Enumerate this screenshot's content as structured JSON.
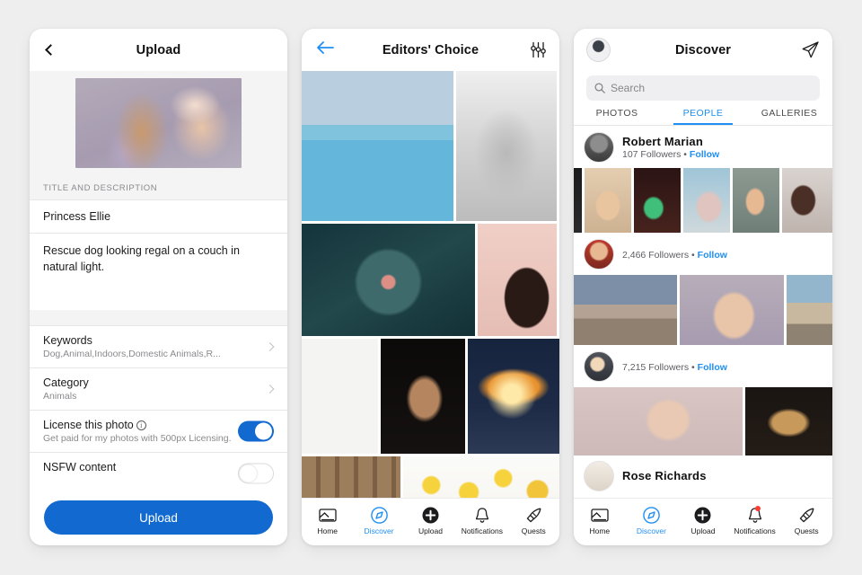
{
  "app": {
    "accent": "#1269cf",
    "tab_accent": "#1f8ff2",
    "bg": "#eeeeee"
  },
  "upload_screen": {
    "nav": {
      "back_icon": "chevron-left-icon",
      "title": "Upload"
    },
    "section_label": "TITLE AND DESCRIPTION",
    "title_value": "Princess Ellie",
    "description_value": "Rescue dog looking regal on a couch in natural light.",
    "keywords": {
      "label": "Keywords",
      "value": "Dog,Animal,Indoors,Domestic Animals,R..."
    },
    "category": {
      "label": "Category",
      "value": "Animals"
    },
    "license": {
      "label": "License this photo",
      "info_icon": "info-circle-icon",
      "sub": "Get paid for my photos with 500px Licensing.",
      "state": "on"
    },
    "nsfw": {
      "label": "NSFW content",
      "state": "off"
    },
    "submit_label": "Upload"
  },
  "editors_screen": {
    "nav": {
      "back_icon": "arrow-left-icon",
      "title": "Editors' Choice",
      "filter_icon": "sliders-icon"
    },
    "tabbar": [
      {
        "label": "Home",
        "icon": "home-image-icon",
        "active": false,
        "badge": false
      },
      {
        "label": "Discover",
        "icon": "compass-icon",
        "active": true,
        "badge": false
      },
      {
        "label": "Upload",
        "icon": "plus-circle-icon",
        "active": false,
        "badge": false
      },
      {
        "label": "Notifications",
        "icon": "bell-icon",
        "active": false,
        "badge": false
      },
      {
        "label": "Quests",
        "icon": "rocket-icon",
        "active": false,
        "badge": false
      }
    ]
  },
  "discover_screen": {
    "nav": {
      "avatar_icon": "user-avatar",
      "title": "Discover",
      "send_icon": "paper-plane-icon"
    },
    "search": {
      "icon": "search-icon",
      "placeholder": "Search",
      "value": ""
    },
    "tabs": [
      {
        "label": "PHOTOS",
        "active": false
      },
      {
        "label": "PEOPLE",
        "active": true
      },
      {
        "label": "GALLERIES",
        "active": false
      }
    ],
    "people": [
      {
        "name": "Robert  Marian",
        "followers": "107 Followers",
        "separator": "•",
        "action": "Follow",
        "name_visible": true
      },
      {
        "name": "",
        "followers": "2,466 Followers",
        "separator": "•",
        "action": "Follow",
        "name_visible": false
      },
      {
        "name": "",
        "followers": "7,215 Followers",
        "separator": "•",
        "action": "Follow",
        "name_visible": false
      },
      {
        "name": "Rose Richards",
        "followers": "",
        "separator": "",
        "action": "",
        "name_visible": true
      }
    ],
    "tabbar": [
      {
        "label": "Home",
        "icon": "home-image-icon",
        "active": false,
        "badge": false
      },
      {
        "label": "Discover",
        "icon": "compass-icon",
        "active": true,
        "badge": false
      },
      {
        "label": "Upload",
        "icon": "plus-circle-icon",
        "active": false,
        "badge": false
      },
      {
        "label": "Notifications",
        "icon": "bell-icon",
        "active": false,
        "badge": true
      },
      {
        "label": "Quests",
        "icon": "rocket-icon",
        "active": false,
        "badge": false
      }
    ]
  }
}
